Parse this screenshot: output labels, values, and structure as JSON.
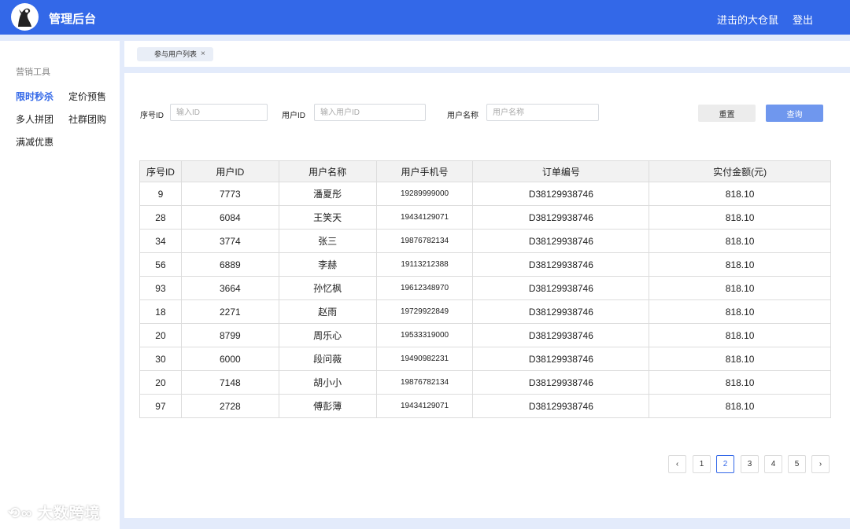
{
  "header": {
    "app_title": "管理后台",
    "user_name": "进击的大仓鼠",
    "logout_label": "登出"
  },
  "sidebar": {
    "heading": "营销工具",
    "items": [
      {
        "label": "限时秒杀",
        "active": true
      },
      {
        "label": "定价预售"
      },
      {
        "label": "多人拼团"
      },
      {
        "label": "社群团购"
      },
      {
        "label": "满减优惠"
      }
    ]
  },
  "watermark": "大数跨境",
  "tabs": [
    {
      "label": "参与用户列表",
      "close": "×"
    }
  ],
  "filters": {
    "seq_id_label": "序号ID",
    "seq_id_placeholder": "输入ID",
    "user_id_label": "用户ID",
    "user_id_placeholder": "输入用户ID",
    "user_name_label": "用户名称",
    "user_name_placeholder": "用户名称",
    "reset_label": "重置",
    "query_label": "查询"
  },
  "table": {
    "columns": [
      "序号ID",
      "用户ID",
      "用户名称",
      "用户手机号",
      "订单编号",
      "实付金额(元)"
    ],
    "rows": [
      [
        "9",
        "7773",
        "潘夏彤",
        "19289999000",
        "D38129938746",
        "818.10"
      ],
      [
        "28",
        "6084",
        "王笑天",
        "19434129071",
        "D38129938746",
        "818.10"
      ],
      [
        "34",
        "3774",
        "张三",
        "19876782134",
        "D38129938746",
        "818.10"
      ],
      [
        "56",
        "6889",
        "李赫",
        "19113212388",
        "D38129938746",
        "818.10"
      ],
      [
        "93",
        "3664",
        "孙忆枫",
        "19612348970",
        "D38129938746",
        "818.10"
      ],
      [
        "18",
        "2271",
        "赵雨",
        "19729922849",
        "D38129938746",
        "818.10"
      ],
      [
        "20",
        "8799",
        "周乐心",
        "19533319000",
        "D38129938746",
        "818.10"
      ],
      [
        "30",
        "6000",
        "段问薇",
        "19490982231",
        "D38129938746",
        "818.10"
      ],
      [
        "20",
        "7148",
        "胡小小",
        "19876782134",
        "D38129938746",
        "818.10"
      ],
      [
        "97",
        "2728",
        "傅彭薄",
        "19434129071",
        "D38129938746",
        "818.10"
      ]
    ]
  },
  "pagination": {
    "prev": "‹",
    "pages": [
      "1",
      "2",
      "3",
      "4",
      "5"
    ],
    "current": "2",
    "next": "›"
  },
  "colors": {
    "brand": "#3368e8",
    "query_button": "#6f97ee",
    "background": "#e3ebfb"
  }
}
